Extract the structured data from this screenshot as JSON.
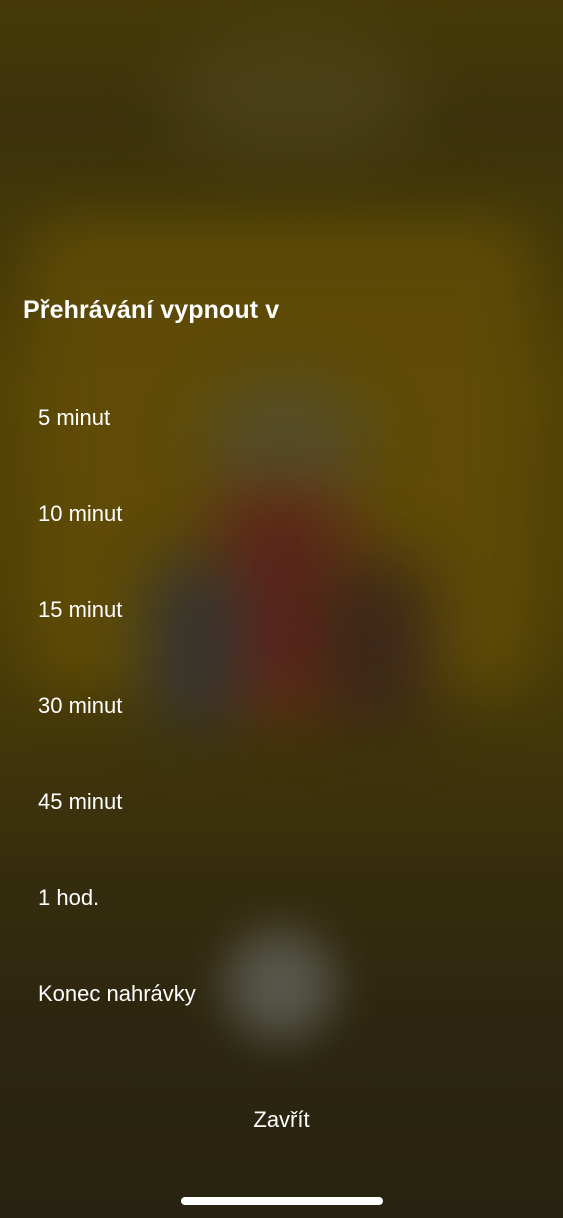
{
  "sheet": {
    "title": "Přehrávání vypnout v",
    "options": [
      {
        "label": "5 minut"
      },
      {
        "label": "10 minut"
      },
      {
        "label": "15 minut"
      },
      {
        "label": "30 minut"
      },
      {
        "label": "45 minut"
      },
      {
        "label": "1 hod."
      },
      {
        "label": "Konec nahrávky"
      }
    ],
    "close_label": "Zavřít"
  },
  "colors": {
    "text": "#ffffff",
    "background_tint": "#4e3f08"
  }
}
